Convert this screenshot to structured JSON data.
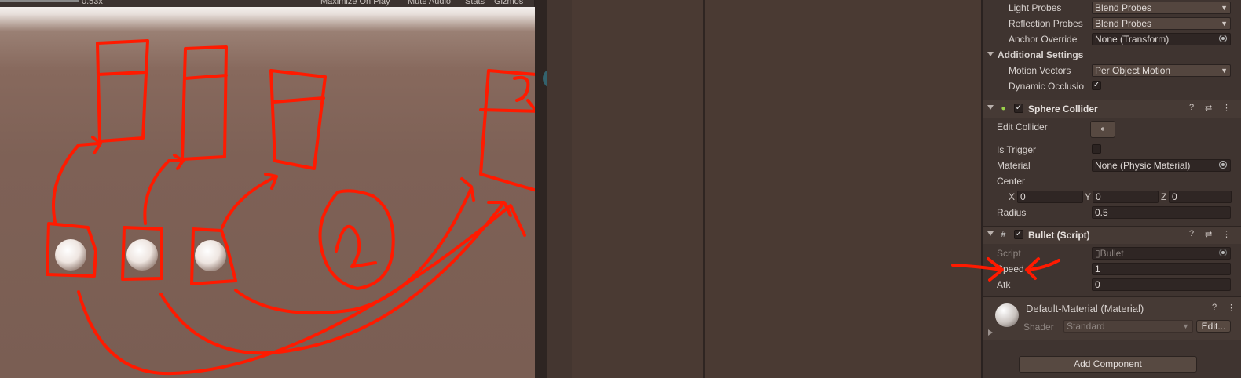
{
  "game_view": {
    "scale_label": "0.53x",
    "maximize_label": "Maximize On Play",
    "mute_label": "Mute Audio",
    "stats_label": "Stats",
    "gizmos_label": "Gizmos",
    "annotation_digit": "2"
  },
  "inspector": {
    "light_probes": {
      "label": "Light Probes",
      "value": "Blend Probes"
    },
    "reflection_probes": {
      "label": "Reflection Probes",
      "value": "Blend Probes"
    },
    "anchor_override": {
      "label": "Anchor Override",
      "value": "None (Transform)"
    },
    "additional_settings": "Additional Settings",
    "motion_vectors": {
      "label": "Motion Vectors",
      "value": "Per Object Motion"
    },
    "dynamic_occlusion": {
      "label": "Dynamic Occlusio",
      "checked": true
    },
    "sphere_collider": {
      "title": "Sphere Collider",
      "enabled": true,
      "edit_collider": "Edit Collider",
      "is_trigger": {
        "label": "Is Trigger",
        "checked": false
      },
      "material": {
        "label": "Material",
        "value": "None (Physic Material)"
      },
      "center": {
        "label": "Center",
        "x_label": "X",
        "x": "0",
        "y_label": "Y",
        "y": "0",
        "z_label": "Z",
        "z": "0"
      },
      "radius": {
        "label": "Radius",
        "value": "0.5"
      }
    },
    "bullet_script": {
      "title": "Bullet (Script)",
      "enabled": true,
      "script": {
        "label": "Script",
        "value": "Bullet"
      },
      "speed": {
        "label": "Speed",
        "value": "1"
      },
      "atk": {
        "label": "Atk",
        "value": "0"
      }
    },
    "material": {
      "title": "Default-Material (Material)",
      "shader_label": "Shader",
      "shader_value": "Standard",
      "edit_label": "Edit..."
    },
    "add_component": "Add Component"
  },
  "colors": {
    "annotation": "#ff1a00",
    "inspector_bg": "#3f3430",
    "cursor_highlight": "#378ca0"
  },
  "icons": [
    "help-icon",
    "preset-icon",
    "kebab-menu-icon",
    "sphere-collider-icon",
    "script-icon",
    "edit-collider-icon",
    "object-picker-icon"
  ]
}
